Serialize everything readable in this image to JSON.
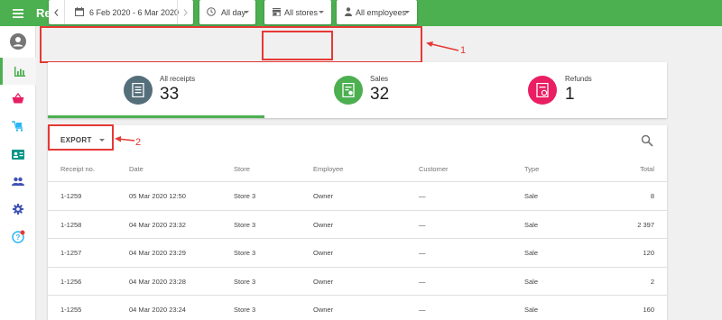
{
  "header": {
    "title": "Receipts"
  },
  "sidebar": {
    "items": [
      {
        "name": "avatar"
      },
      {
        "name": "reports-icon"
      },
      {
        "name": "items-icon"
      },
      {
        "name": "inventory-icon"
      },
      {
        "name": "employees-icon"
      },
      {
        "name": "customers-icon"
      },
      {
        "name": "settings-icon"
      },
      {
        "name": "help-icon"
      }
    ]
  },
  "filters": {
    "date_range": "6 Feb 2020 - 6 Mar 2020",
    "time": "All day",
    "stores": "All stores",
    "employees": "All employees"
  },
  "annotations": {
    "one": "1",
    "two": "2"
  },
  "summary": {
    "all_receipts": {
      "label": "All receipts",
      "value": "33",
      "color": "#546e7a"
    },
    "sales": {
      "label": "Sales",
      "value": "32",
      "color": "#4caf50"
    },
    "refunds": {
      "label": "Refunds",
      "value": "1",
      "color": "#e91e63"
    }
  },
  "table": {
    "export_label": "EXPORT",
    "columns": {
      "receipt_no": "Receipt no.",
      "date": "Date",
      "store": "Store",
      "employee": "Employee",
      "customer": "Customer",
      "type": "Type",
      "total": "Total"
    },
    "rows": [
      {
        "receipt_no": "1-1259",
        "date": "05 Mar 2020 12:50",
        "store": "Store 3",
        "employee": "Owner",
        "customer": "—",
        "type": "Sale",
        "total": "8"
      },
      {
        "receipt_no": "1-1258",
        "date": "04 Mar 2020 23:32",
        "store": "Store 3",
        "employee": "Owner",
        "customer": "—",
        "type": "Sale",
        "total": "2 397"
      },
      {
        "receipt_no": "1-1257",
        "date": "04 Mar 2020 23:29",
        "store": "Store 3",
        "employee": "Owner",
        "customer": "—",
        "type": "Sale",
        "total": "120"
      },
      {
        "receipt_no": "1-1256",
        "date": "04 Mar 2020 23:28",
        "store": "Store 3",
        "employee": "Owner",
        "customer": "—",
        "type": "Sale",
        "total": "2"
      },
      {
        "receipt_no": "1-1255",
        "date": "04 Mar 2020 23:24",
        "store": "Store 3",
        "employee": "Owner",
        "customer": "—",
        "type": "Sale",
        "total": "160"
      }
    ]
  },
  "colors": {
    "brand": "#4caf50",
    "annotation": "#e53935"
  }
}
